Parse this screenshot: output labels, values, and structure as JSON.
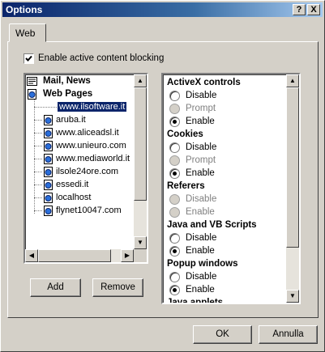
{
  "window": {
    "title": "Options",
    "help_label": "?",
    "close_label": "X"
  },
  "tabs": [
    {
      "label": "Web"
    }
  ],
  "blocking_checkbox": {
    "label": "Enable active content blocking",
    "checked": true
  },
  "tree": {
    "items": [
      {
        "label": "Mail, News",
        "icon": "mail-news-icon"
      },
      {
        "label": "Web Pages",
        "icon": "web-pages-icon"
      },
      {
        "label": "www.ilsoftware.it",
        "selected": true
      },
      {
        "label": "aruba.it",
        "icon": "globe-page-icon"
      },
      {
        "label": "www.aliceadsl.it",
        "icon": "globe-page-icon"
      },
      {
        "label": "www.unieuro.com",
        "icon": "globe-page-icon"
      },
      {
        "label": "www.mediaworld.it",
        "icon": "globe-page-icon"
      },
      {
        "label": "ilsole24ore.com",
        "icon": "globe-page-icon"
      },
      {
        "label": "essedi.it",
        "icon": "globe-page-icon"
      },
      {
        "label": "localhost",
        "icon": "globe-page-icon"
      },
      {
        "label": "flynet10047.com",
        "icon": "globe-page-icon"
      }
    ]
  },
  "buttons": {
    "add": "Add",
    "remove": "Remove",
    "ok": "OK",
    "cancel": "Annulla"
  },
  "settings": {
    "activex": {
      "title": "ActiveX controls",
      "options": [
        "Disable",
        "Prompt",
        "Enable"
      ],
      "selected": "Enable"
    },
    "cookies": {
      "title": "Cookies",
      "options": [
        "Disable",
        "Prompt",
        "Enable"
      ],
      "selected": "Enable"
    },
    "referers": {
      "title": "Referers",
      "options": [
        "Disable",
        "Enable"
      ],
      "selected": null
    },
    "scripts": {
      "title": "Java and VB Scripts",
      "options": [
        "Disable",
        "Enable"
      ],
      "selected": "Enable"
    },
    "popups": {
      "title": "Popup windows",
      "options": [
        "Disable",
        "Enable"
      ],
      "selected": "Enable"
    },
    "java": {
      "title": "Java applets"
    }
  },
  "colors": {
    "title_bar": "#0a246a",
    "selection": "#0a246a",
    "face": "#d4d0c8"
  }
}
